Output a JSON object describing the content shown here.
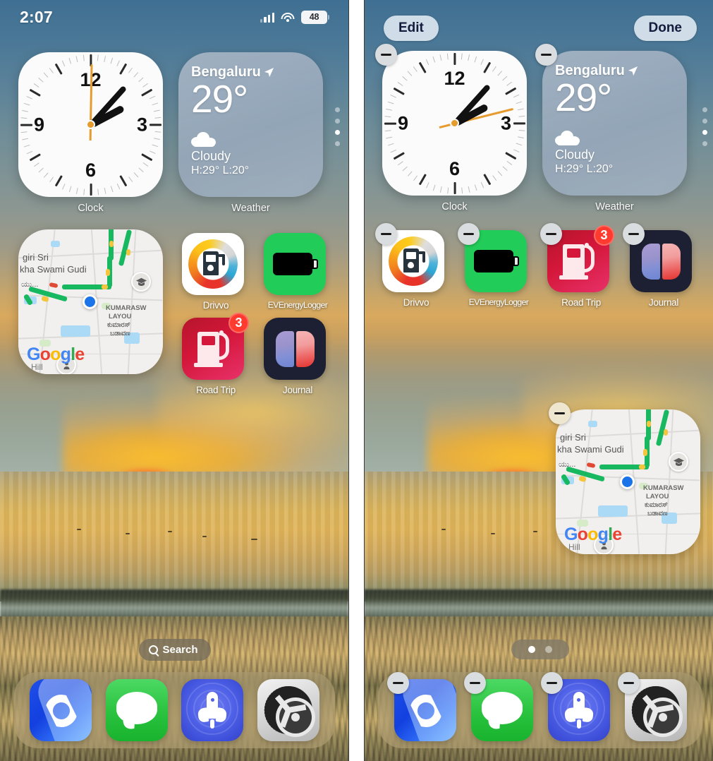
{
  "status_bar": {
    "time": "2:07",
    "battery_percent": "48",
    "signal_icon": "cellular-signal-icon",
    "wifi_icon": "wifi-icon",
    "battery_icon": "battery-icon"
  },
  "edit_bar": {
    "edit_label": "Edit",
    "done_label": "Done"
  },
  "widgets": {
    "clock": {
      "label": "Clock",
      "numbers": [
        "12",
        "3",
        "6",
        "9"
      ],
      "hour_angle_deg": 62,
      "minute_angle_deg": 42,
      "second_angle_deg": 1
    },
    "clock_right": {
      "label": "Clock",
      "hour_angle_deg": 62,
      "minute_angle_deg": 42,
      "second_angle_deg": 76
    },
    "weather": {
      "label": "Weather",
      "city": "Bengaluru",
      "location_icon": "location-arrow-icon",
      "temperature": "29°",
      "condition_icon": "cloud-icon",
      "condition": "Cloudy",
      "high_low": "H:29° L:20°"
    },
    "google_maps": {
      "label": "Google Maps",
      "place_line1": "giri Sri",
      "place_line2": "kha Swami Gudi",
      "place_line3": "ಯು...",
      "area_line1": "KUMARASW",
      "area_line2": "LAYOU",
      "area_line3": "ಕುಮಾರಸ್",
      "area_line4": "ಬಡಾವಣ",
      "street_label": "Hill",
      "brand": "Google",
      "brand_letters": [
        "G",
        "o",
        "o",
        "g",
        "l",
        "e"
      ]
    },
    "page_dots": {
      "count": 4,
      "active_index": 2
    }
  },
  "apps_left": [
    {
      "name": "Drivvo",
      "icon": "drivvo-icon",
      "badge": null
    },
    {
      "name": "EVEnergyLogger",
      "icon": "evenergylogger-icon",
      "badge": null
    },
    {
      "name": "Road Trip",
      "icon": "road-trip-icon",
      "badge": "3"
    },
    {
      "name": "Journal",
      "icon": "journal-icon",
      "badge": null
    }
  ],
  "apps_right": [
    {
      "name": "Drivvo",
      "icon": "drivvo-icon",
      "badge": null
    },
    {
      "name": "EVEnergyLogger",
      "icon": "evenergylogger-icon",
      "badge": null
    },
    {
      "name": "Road Trip",
      "icon": "road-trip-icon",
      "badge": "3"
    },
    {
      "name": "Journal",
      "icon": "journal-icon",
      "badge": null
    }
  ],
  "dock": [
    {
      "name": "Phone",
      "icon": "phone-icon"
    },
    {
      "name": "Messages",
      "icon": "messages-icon"
    },
    {
      "name": "Launcher",
      "icon": "rocket-icon"
    },
    {
      "name": "Settings",
      "icon": "settings-gear-icon"
    }
  ],
  "search": {
    "label": "Search",
    "icon": "search-icon"
  },
  "page_indicator": {
    "count": 2,
    "active_index": 0
  },
  "remove_badge": {
    "icon": "minus-icon"
  },
  "colors": {
    "accent_blue": "#1a73e8",
    "badge_red": "#ff3b30",
    "dock_tint": "rgba(200,180,140,0.38)",
    "edit_pill": "#e2ecf4",
    "edit_text": "#141b3d",
    "green_app": "#21cc59",
    "road_trip_red": "#d4173a",
    "journal_navy": "#1d1f33",
    "clock_second_hand": "#e59b2d"
  }
}
